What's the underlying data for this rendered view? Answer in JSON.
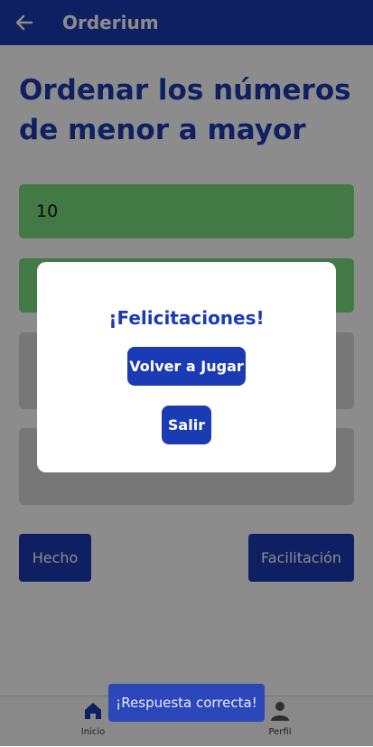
{
  "appbar": {
    "title": "Orderium",
    "back_icon": "arrow-left-icon"
  },
  "main": {
    "heading": "Ordenar los números de menor a mayor",
    "cards": [
      "10",
      "",
      "",
      ""
    ],
    "done_button": "Hecho",
    "help_button": "Facilitación"
  },
  "dialog": {
    "title": "¡Felicitaciones!",
    "replay_button": "Volver a Jugar",
    "exit_button": "Salir"
  },
  "toast": "¡Respuesta correcta!",
  "bottom_nav": [
    {
      "label": "Inicio",
      "icon": "home-icon"
    },
    {
      "label": "Perfil",
      "icon": "person-icon"
    }
  ],
  "colors": {
    "primary": "#1a3bb3",
    "correct": "#7bdc7f",
    "neutral": "#d9d9d9"
  }
}
